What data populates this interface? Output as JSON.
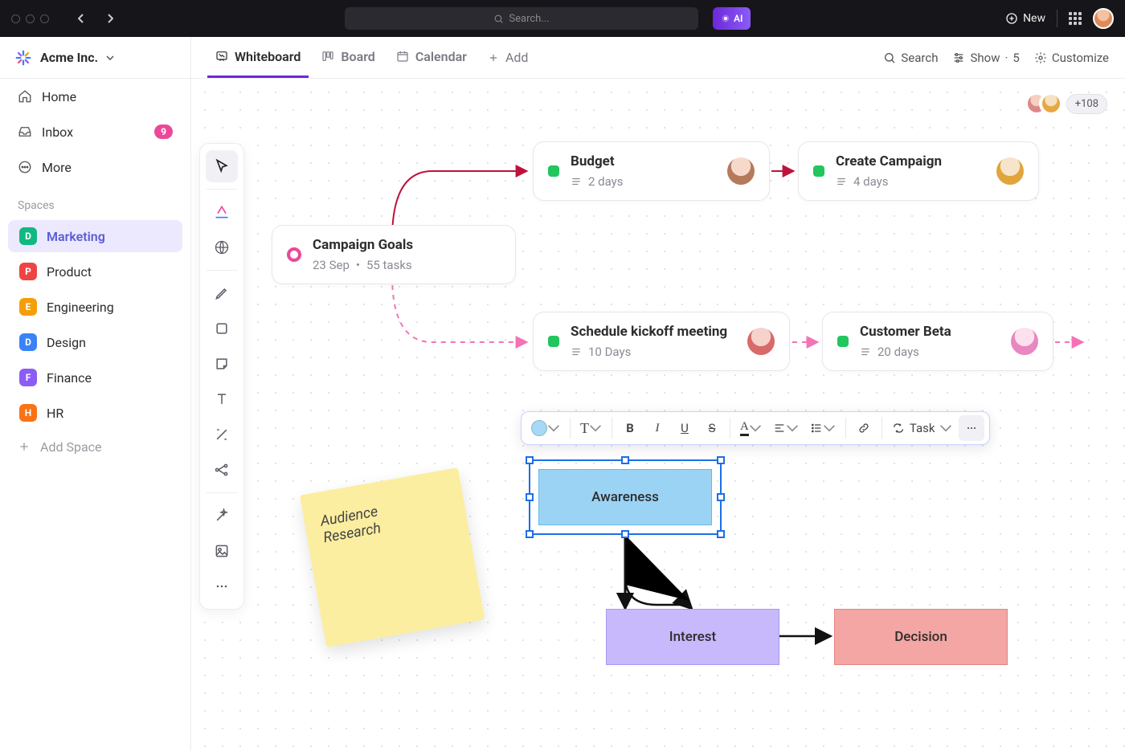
{
  "titlebar": {
    "search_placeholder": "Search...",
    "ai_label": "AI",
    "new_label": "New"
  },
  "sidebar": {
    "workspace": "Acme Inc.",
    "nav": [
      {
        "label": "Home",
        "icon": "home-icon"
      },
      {
        "label": "Inbox",
        "icon": "inbox-icon",
        "badge": "9"
      },
      {
        "label": "More",
        "icon": "more-icon"
      }
    ],
    "spaces_header": "Spaces",
    "spaces": [
      {
        "letter": "D",
        "label": "Marketing",
        "color": "#10b981",
        "active": true
      },
      {
        "letter": "P",
        "label": "Product",
        "color": "#ef4444"
      },
      {
        "letter": "E",
        "label": "Engineering",
        "color": "#f59e0b"
      },
      {
        "letter": "D",
        "label": "Design",
        "color": "#3b82f6"
      },
      {
        "letter": "F",
        "label": "Finance",
        "color": "#8b5cf6"
      },
      {
        "letter": "H",
        "label": "HR",
        "color": "#f97316"
      }
    ],
    "add_space": "Add Space"
  },
  "viewbar": {
    "tabs": [
      {
        "label": "Whiteboard",
        "active": true
      },
      {
        "label": "Board"
      },
      {
        "label": "Calendar"
      }
    ],
    "add_label": "Add",
    "search_label": "Search",
    "show_label": "Show",
    "show_count": "5",
    "customize_label": "Customize"
  },
  "collaborators": {
    "more_count": "+108"
  },
  "nodes": {
    "campaign_goals": {
      "title": "Campaign Goals",
      "date": "23 Sep",
      "tasks": "55 tasks"
    },
    "budget": {
      "title": "Budget",
      "sub": "2 days"
    },
    "create_campaign": {
      "title": "Create Campaign",
      "sub": "4 days"
    },
    "kickoff": {
      "title": "Schedule kickoff meeting",
      "sub": "10 Days"
    },
    "beta": {
      "title": "Customer Beta",
      "sub": "20 days"
    }
  },
  "sticky": {
    "line1": "Audience",
    "line2": "Research"
  },
  "shapes": {
    "awareness": "Awareness",
    "interest": "Interest",
    "decision": "Decision"
  },
  "fmt_toolbar": {
    "task_label": "Task"
  },
  "colors": {
    "purple": "#6d28d9",
    "pink": "#ec4899",
    "green": "#22c55e",
    "awareness_fill": "#a7d8f7",
    "interest_fill": "#c4b5fd",
    "decision_fill": "#f5a9a9"
  }
}
